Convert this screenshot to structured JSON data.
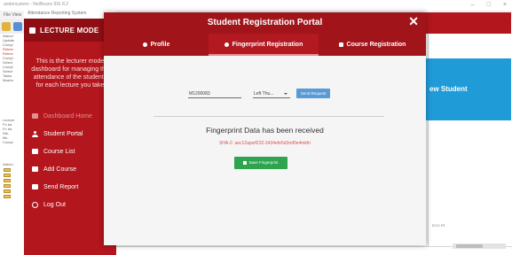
{
  "ide": {
    "title": "andersystem - NetBeans IDE 8.2",
    "menu_label": "File View",
    "window_controls": [
      "–",
      "□",
      "×"
    ],
    "close_glyph": "×",
    "tree_lines": [
      "Attend",
      "Update",
      "Compl",
      "Retest",
      "Retest",
      "Compl",
      "Select",
      "Compl",
      "Select",
      "Tasks",
      "Mastro"
    ],
    "tree_lines_lower": [
      "Lecture",
      "Fo ba",
      "Fo ba",
      "Ste-",
      "lite-",
      "Compl"
    ],
    "tree_panel_label": "Attend",
    "mini_tag": "ECO FE"
  },
  "lecturer_window": {
    "title_bar": "Attendance Reporting System",
    "header_title": "LECTURE MODE",
    "description": "This is the lecturer mode dashboard for managing the attendance of the students for each lecture you take",
    "nav": [
      {
        "label": "Dashboard Home",
        "icon": "home-icon",
        "dim": true
      },
      {
        "label": "Student Portal",
        "icon": "user-icon",
        "dim": false
      },
      {
        "label": "Course List",
        "icon": "list-icon",
        "dim": false
      },
      {
        "label": "Add Course",
        "icon": "folder-icon",
        "dim": false
      },
      {
        "label": "Send Report",
        "icon": "file-icon",
        "dim": false
      },
      {
        "label": "Log Out",
        "icon": "power-icon",
        "dim": false
      }
    ]
  },
  "background_card": {
    "label": "ew Student"
  },
  "portal": {
    "title": "Student Registration Portal",
    "close_glyph": "✕",
    "tabs": [
      {
        "label": "Profile",
        "icon": "user-icon",
        "active": false
      },
      {
        "label": "Fingerprint Registration",
        "icon": "fingerprint-icon",
        "active": true
      },
      {
        "label": "Course Registration",
        "icon": "book-icon",
        "active": false
      }
    ],
    "student_id_value": "M1200083",
    "finger_select_value": "Left Thu...",
    "send_button_label": "Send Request",
    "status_text": "Fingerprint Data has been received",
    "hash_text": "SHA-2: aec12apoif232-3434efe5d3mf0e4mkfn",
    "save_button_label": "Save Fingerprint"
  },
  "colors": {
    "brand_red": "#b3161c",
    "dark_red": "#a11419",
    "accent_blue": "#1f9bd7",
    "success_green": "#2ea44f",
    "hash_red": "#d9534f"
  }
}
